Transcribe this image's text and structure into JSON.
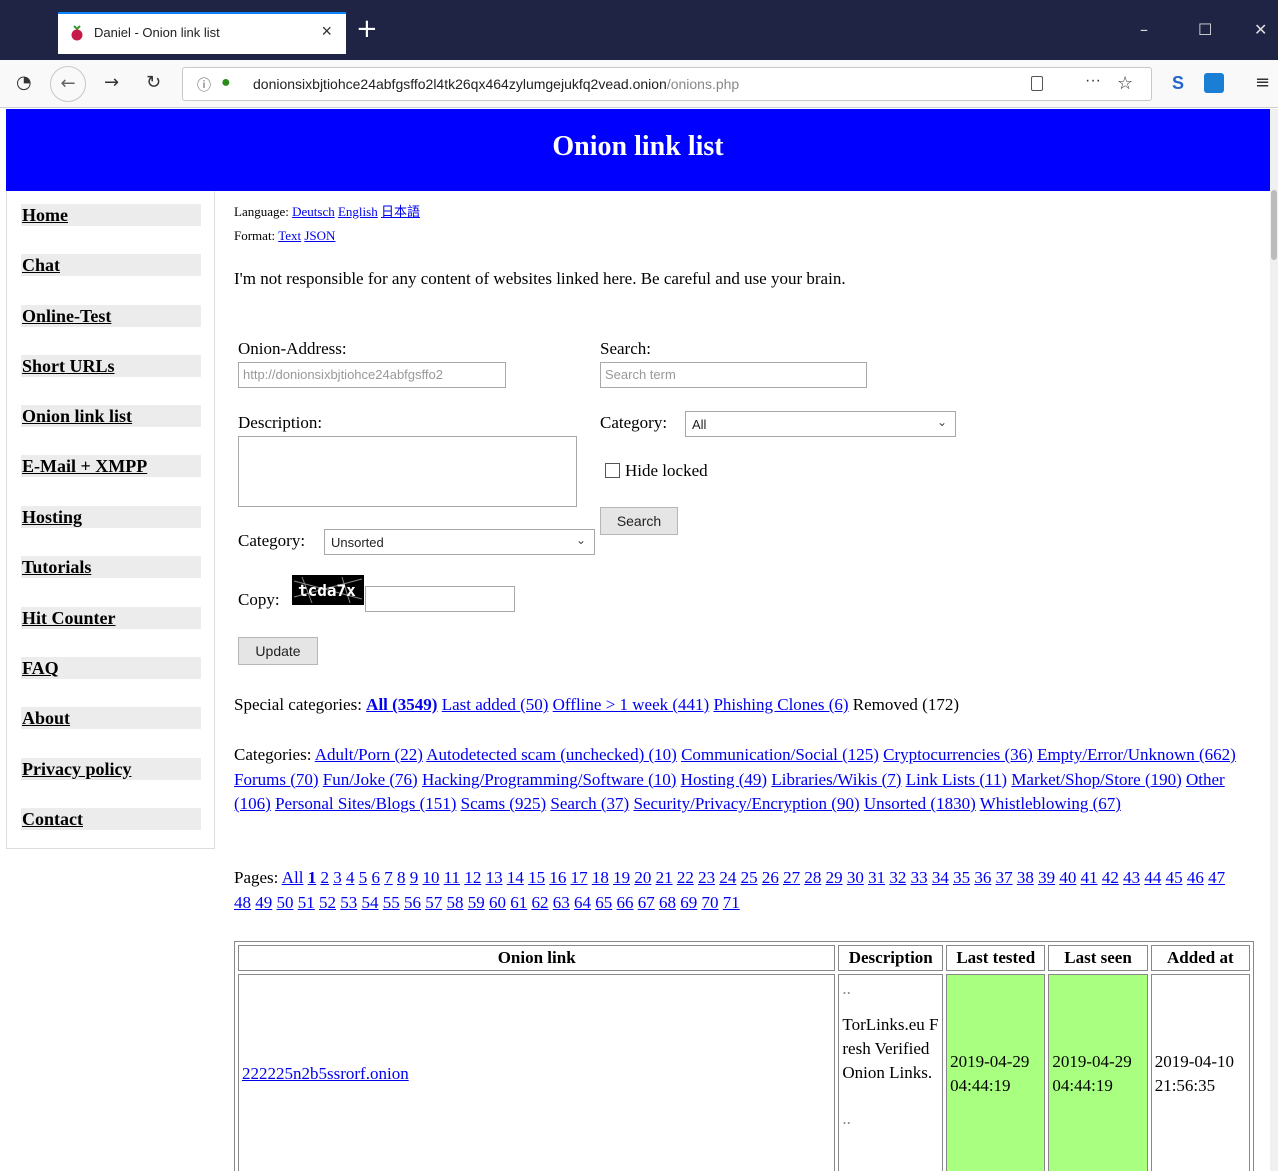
{
  "browser": {
    "tab_title": "Daniel - Onion link list",
    "url_host": "donionsixbjtiohce24abfgsffo2l4tk26qx464zylumgejukfq2vead.onion",
    "url_path": "/onions.php"
  },
  "header": {
    "title": "Onion link list"
  },
  "sidebar": {
    "items": [
      {
        "label": "Home"
      },
      {
        "label": "Chat"
      },
      {
        "label": "Online-Test"
      },
      {
        "label": "Short URLs"
      },
      {
        "label": "Onion link list"
      },
      {
        "label": "E-Mail + XMPP"
      },
      {
        "label": "Hosting"
      },
      {
        "label": "Tutorials"
      },
      {
        "label": "Hit Counter"
      },
      {
        "label": "FAQ"
      },
      {
        "label": "About"
      },
      {
        "label": "Privacy policy"
      },
      {
        "label": "Contact"
      }
    ]
  },
  "language": {
    "label": "Language:",
    "options": [
      "Deutsch",
      "English",
      "日本語"
    ]
  },
  "format": {
    "label": "Format:",
    "options": [
      "Text",
      "JSON"
    ]
  },
  "disclaimer": "I'm not responsible for any content of websites linked here. Be careful and use your brain.",
  "form": {
    "onion_label": "Onion-Address:",
    "onion_value": "http://donionsixbjtiohce24abfgsffo2",
    "description_label": "Description:",
    "category_label": "Category:",
    "category_value": "Unsorted",
    "copy_label": "Copy:",
    "captcha_text": "tcda7x",
    "update_button": "Update",
    "search_label": "Search:",
    "search_placeholder": "Search term",
    "search_category_label": "Category:",
    "search_category_value": "All",
    "hide_locked_label": "Hide locked",
    "search_button": "Search"
  },
  "special": {
    "label": "Special categories:",
    "all": "All (3549)",
    "last_added": "Last added (50)",
    "offline": "Offline > 1 week (441)",
    "phishing": "Phishing Clones (6)",
    "removed": "Removed (172)"
  },
  "categories": {
    "label": "Categories:",
    "items": [
      "Adult/Porn (22)",
      "Autodetected scam (unchecked) (10)",
      "Communication/Social (125)",
      "Cryptocurrencies (36)",
      "Empty/Error/Unknown (662)",
      "Forums (70)",
      "Fun/Joke (76)",
      "Hacking/Programming/Software (10)",
      "Hosting (49)",
      "Libraries/Wikis (7)",
      "Link Lists (11)",
      "Market/Shop/Store (190)",
      "Other (106)",
      "Personal Sites/Blogs (151)",
      "Scams (925)",
      "Search (37)",
      "Security/Privacy/Encryption (90)",
      "Unsorted (1830)",
      "Whistleblowing (67)"
    ]
  },
  "pages": {
    "label": "Pages:",
    "all": "All",
    "current": "1",
    "last": 71
  },
  "table": {
    "headers": [
      "Onion link",
      "Description",
      "Last tested",
      "Last seen",
      "Added at"
    ],
    "row": {
      "link": "222225n2b5ssrorf.onion",
      "desc_line1": "..",
      "desc_body": "TorLinks.eu Fresh Verified Onion Links.",
      "desc_line2": "..",
      "last_tested": "2019-04-29 04:44:19",
      "last_seen": "2019-04-29 04:44:19",
      "added_at": "2019-04-10 21:56:35"
    }
  }
}
